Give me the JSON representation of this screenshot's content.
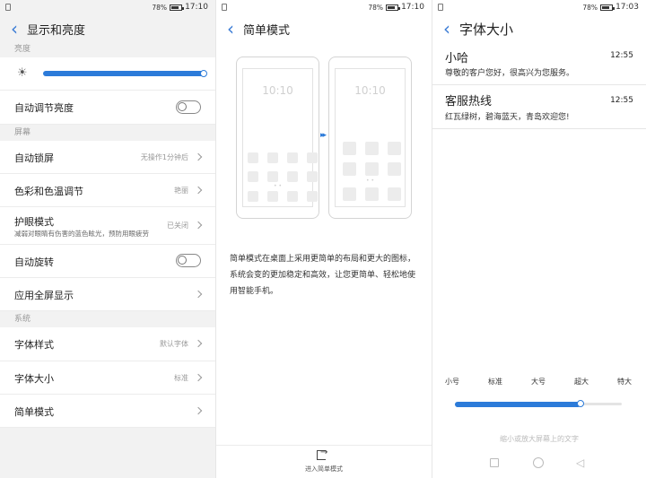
{
  "left": {
    "status": {
      "battery": "78%",
      "time": "17:10"
    },
    "title": "显示和亮度",
    "sections": {
      "brightness": "亮度",
      "screen": "屏幕",
      "system": "系统"
    },
    "brightness_level_percent": 100,
    "rows": {
      "auto_brightness": "自动调节亮度",
      "auto_lock": {
        "label": "自动锁屏",
        "value": "无操作1分钟后"
      },
      "color_temp": {
        "label": "色彩和色温调节",
        "value": "艳丽"
      },
      "eye_care": {
        "label": "护眼模式",
        "sub": "减弱对眼睛有伤害的蓝色眩光，预防用眼疲劳",
        "value": "已关闭"
      },
      "auto_rotate": "自动旋转",
      "fullscreen": "应用全屏显示",
      "font_style": {
        "label": "字体样式",
        "value": "默认字体"
      },
      "font_size": {
        "label": "字体大小",
        "value": "标准"
      },
      "simple_mode": "简单模式"
    },
    "toggles": {
      "auto_brightness": false,
      "auto_rotate": false
    }
  },
  "middle": {
    "status": {
      "battery": "78%",
      "time": "17:10"
    },
    "title": "简单模式",
    "preview_clock": "10:10",
    "description": "简单模式在桌面上采用更简单的布局和更大的图标，系统会变的更加稳定和高效，让您更简单、轻松地使用智能手机。",
    "enter_button": "进入简单模式"
  },
  "right": {
    "status": {
      "battery": "78%",
      "time": "17:03"
    },
    "title": "字体大小",
    "messages": [
      {
        "name": "小哈",
        "time": "12:55",
        "text": "尊敬的客户您好，很高兴为您服务。"
      },
      {
        "name": "客服热线",
        "time": "12:55",
        "text": "红瓦绿树，碧海蓝天，青岛欢迎您!"
      }
    ],
    "size_labels": [
      "小号",
      "标准",
      "大号",
      "超大",
      "特大"
    ],
    "selected_size": "超大",
    "hint": "缩小或放大屏幕上的文字"
  },
  "icons": {
    "back": "chevron-left-icon",
    "chevron": "chevron-right-icon",
    "brightness": "sun-icon",
    "enter": "enter-icon"
  },
  "colors": {
    "accent": "#2c7bd9",
    "back_arrow": "#3a7bd5"
  }
}
